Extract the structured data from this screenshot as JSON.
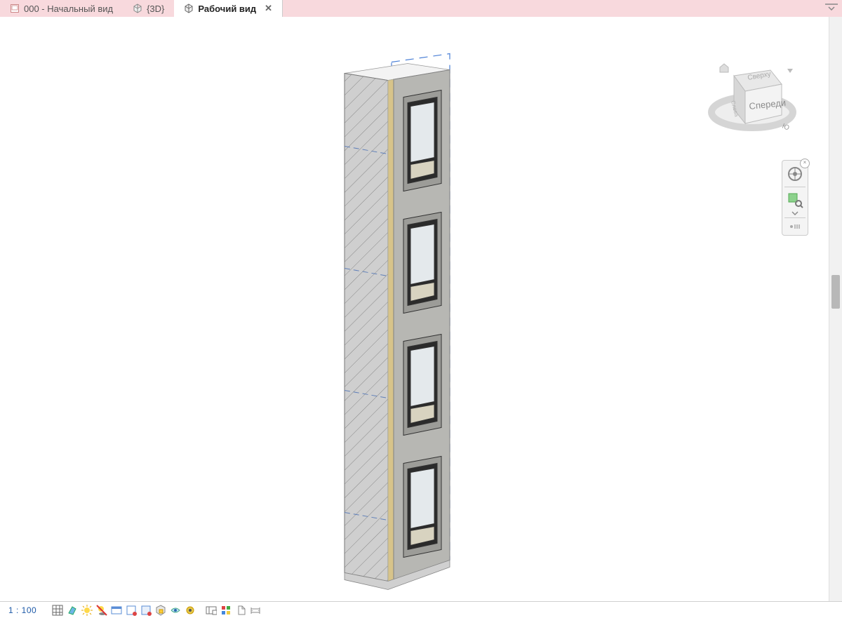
{
  "tabs": {
    "items": [
      {
        "label": "000 - Начальный вид",
        "active": false,
        "icon": "sheet"
      },
      {
        "label": "{3D}",
        "active": false,
        "icon": "cube"
      },
      {
        "label": "Рабочий вид",
        "active": true,
        "icon": "cube"
      }
    ]
  },
  "viewCube": {
    "front": "Спереди",
    "top": "Сверху",
    "left": "Слева",
    "south": "Ю"
  },
  "statusBar": {
    "scale": "1 : 100"
  },
  "navPanel": {
    "wheel": "steering-wheel",
    "zoom": "zoom-region"
  }
}
